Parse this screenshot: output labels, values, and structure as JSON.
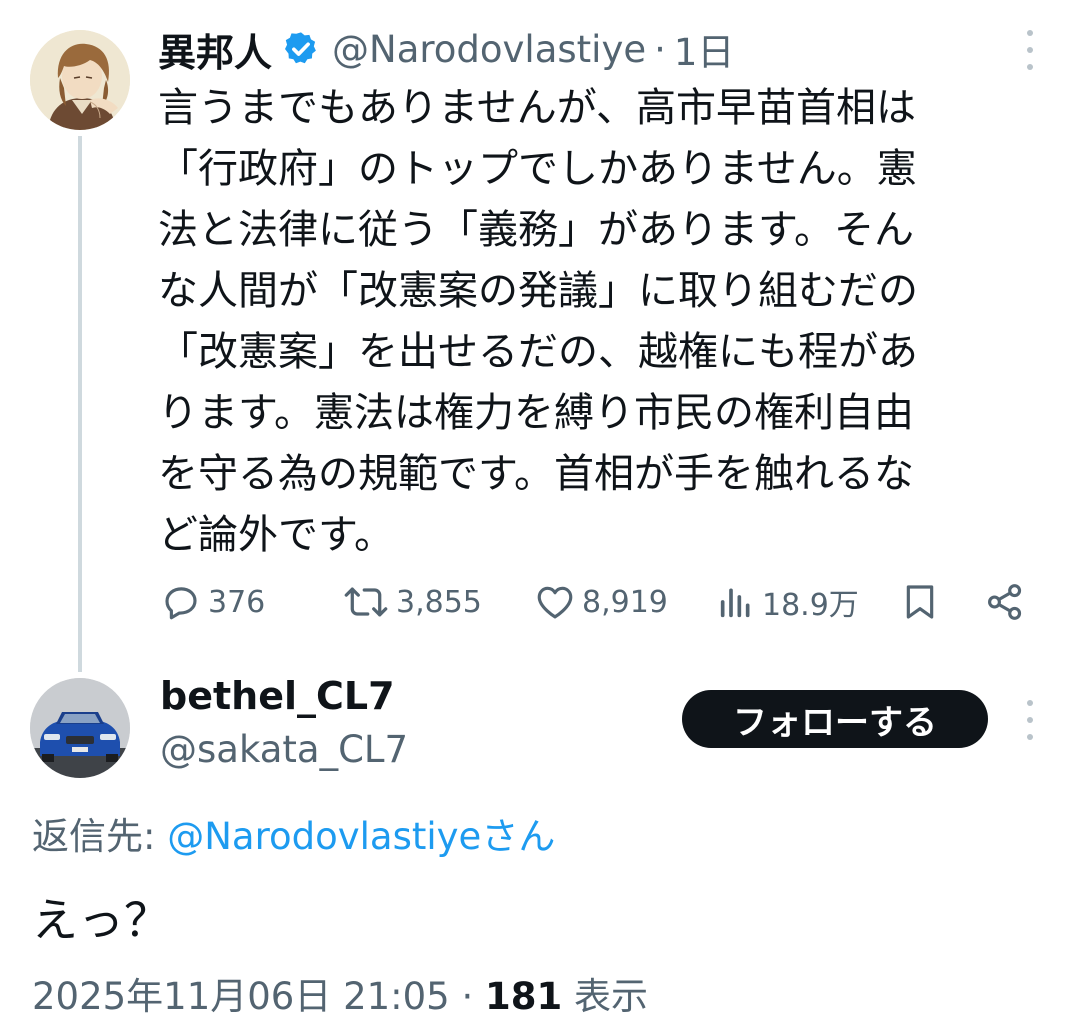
{
  "parent_tweet": {
    "author": {
      "name": "異邦人",
      "handle": "@Narodovlastiye",
      "verified": true
    },
    "separator": "·",
    "time": "1日",
    "text": "言うまでもありませんが、高市早苗首相は\n「行政府」のトップでしかありません。憲\n法と法律に従う「義務」があります。そん\nな人間が「改憲案の発議」に取り組むだの\n「改憲案」を出せるだの、越権にも程があ\nります。憲法は権力を縛り市民の権利自由\nを守る為の規範です。首相が手を触れるな\nど論外です。",
    "stats": {
      "replies": "376",
      "retweets": "3,855",
      "likes": "8,919",
      "views": "18.9万"
    }
  },
  "reply_tweet": {
    "author": {
      "name": "bethel_CL7",
      "handle": "@sakata_CL7"
    },
    "follow_label": "フォローする",
    "reply_to_label": "返信先: ",
    "reply_to_mention": "@Narodovlastiye",
    "reply_to_suffix": "さん",
    "text": "えっ？",
    "timestamp": "2025年11月06日 21:05",
    "separator": " · ",
    "views_count": "181",
    "views_label": " 表示"
  },
  "colors": {
    "accent": "#1d9bf0",
    "text": "#0f1419",
    "muted": "#536471",
    "thread_line": "#cfd9de",
    "follow_button": "#0f1419"
  },
  "icons": [
    "more-icon",
    "verified-badge-icon",
    "reply-icon",
    "retweet-icon",
    "like-icon",
    "views-icon",
    "bookmark-icon",
    "share-icon",
    "avatar-illustration",
    "avatar-car"
  ]
}
